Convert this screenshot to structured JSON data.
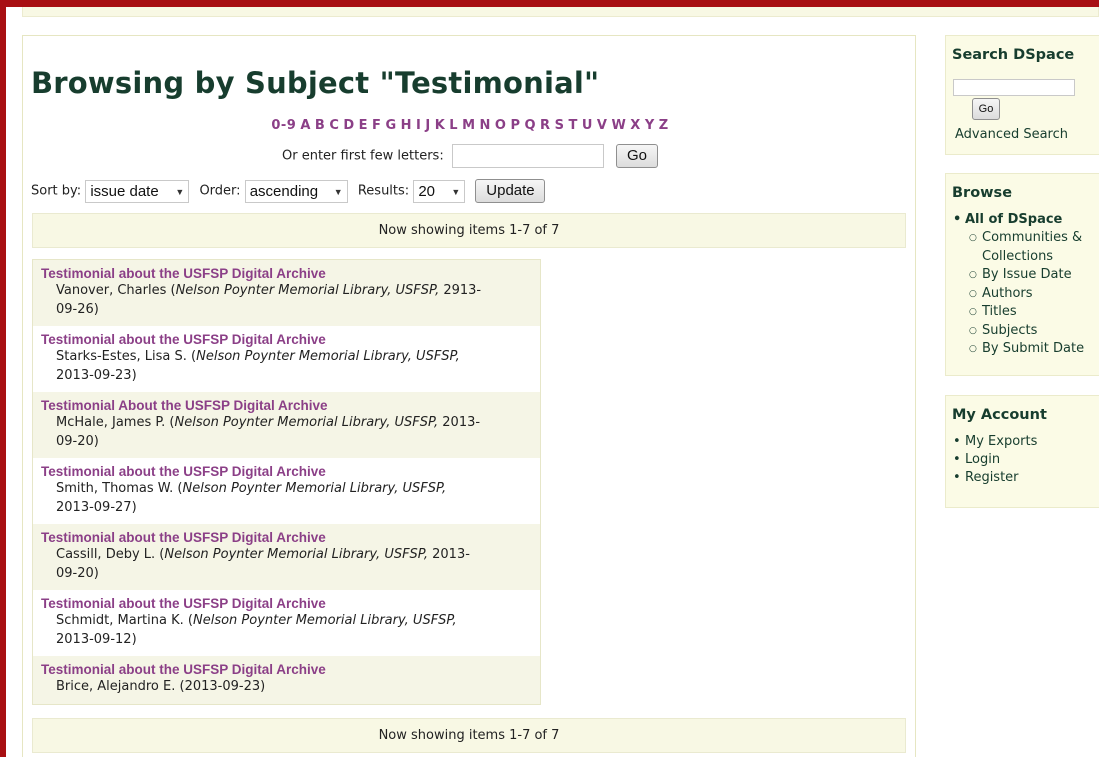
{
  "page_title": "Browsing by Subject \"Testimonial\"",
  "jump_letters": [
    "0-9",
    "A",
    "B",
    "C",
    "D",
    "E",
    "F",
    "G",
    "H",
    "I",
    "J",
    "K",
    "L",
    "M",
    "N",
    "O",
    "P",
    "Q",
    "R",
    "S",
    "T",
    "U",
    "V",
    "W",
    "X",
    "Y",
    "Z"
  ],
  "first_letters": {
    "label": "Or enter first few letters:",
    "value": "",
    "go_label": "Go"
  },
  "sort": {
    "sort_by_label": "Sort by:",
    "sort_by_value": "issue date",
    "order_label": "Order:",
    "order_value": "ascending",
    "results_label": "Results:",
    "results_value": "20",
    "update_label": "Update"
  },
  "showing_text": "Now showing items 1-7 of 7",
  "items": [
    {
      "title": "Testimonial about the USFSP Digital Archive",
      "author": "Vanover, Charles",
      "publisher": "Nelson Poynter Memorial Library, USFSP,",
      "date": "2913-09-26"
    },
    {
      "title": "Testimonial about the USFSP Digital Archive",
      "author": "Starks-Estes, Lisa S.",
      "publisher": "Nelson Poynter Memorial Library, USFSP,",
      "date": "2013-09-23"
    },
    {
      "title": "Testimonial About the USFSP Digital Archive",
      "author": "McHale, James P.",
      "publisher": "Nelson Poynter Memorial Library, USFSP,",
      "date": "2013-09-20"
    },
    {
      "title": "Testimonial about the USFSP Digital Archive",
      "author": "Smith, Thomas W.",
      "publisher": "Nelson Poynter Memorial Library, USFSP,",
      "date": "2013-09-27"
    },
    {
      "title": "Testimonial about the USFSP Digital Archive",
      "author": "Cassill, Deby L.",
      "publisher": "Nelson Poynter Memorial Library, USFSP,",
      "date": "2013-09-20"
    },
    {
      "title": "Testimonial about the USFSP Digital Archive",
      "author": "Schmidt, Martina K.",
      "publisher": "Nelson Poynter Memorial Library, USFSP,",
      "date": "2013-09-12"
    },
    {
      "title": "Testimonial about the USFSP Digital Archive",
      "author": "Brice, Alejandro E.",
      "publisher": "",
      "date": "2013-09-23"
    }
  ],
  "sidebar": {
    "search": {
      "heading": "Search DSpace",
      "go_label": "Go",
      "advanced_label": "Advanced Search"
    },
    "browse": {
      "heading": "Browse",
      "top_item": "All of DSpace",
      "sub_items": [
        "Communities & Collections",
        "By Issue Date",
        "Authors",
        "Titles",
        "Subjects",
        "By Submit Date"
      ]
    },
    "account": {
      "heading": "My Account",
      "items": [
        "My Exports",
        "Login",
        "Register"
      ]
    }
  },
  "colors": {
    "frame": "#a80f12",
    "heading": "#173d2e",
    "link": "#8b3f87",
    "panel": "#f8f8e4"
  }
}
